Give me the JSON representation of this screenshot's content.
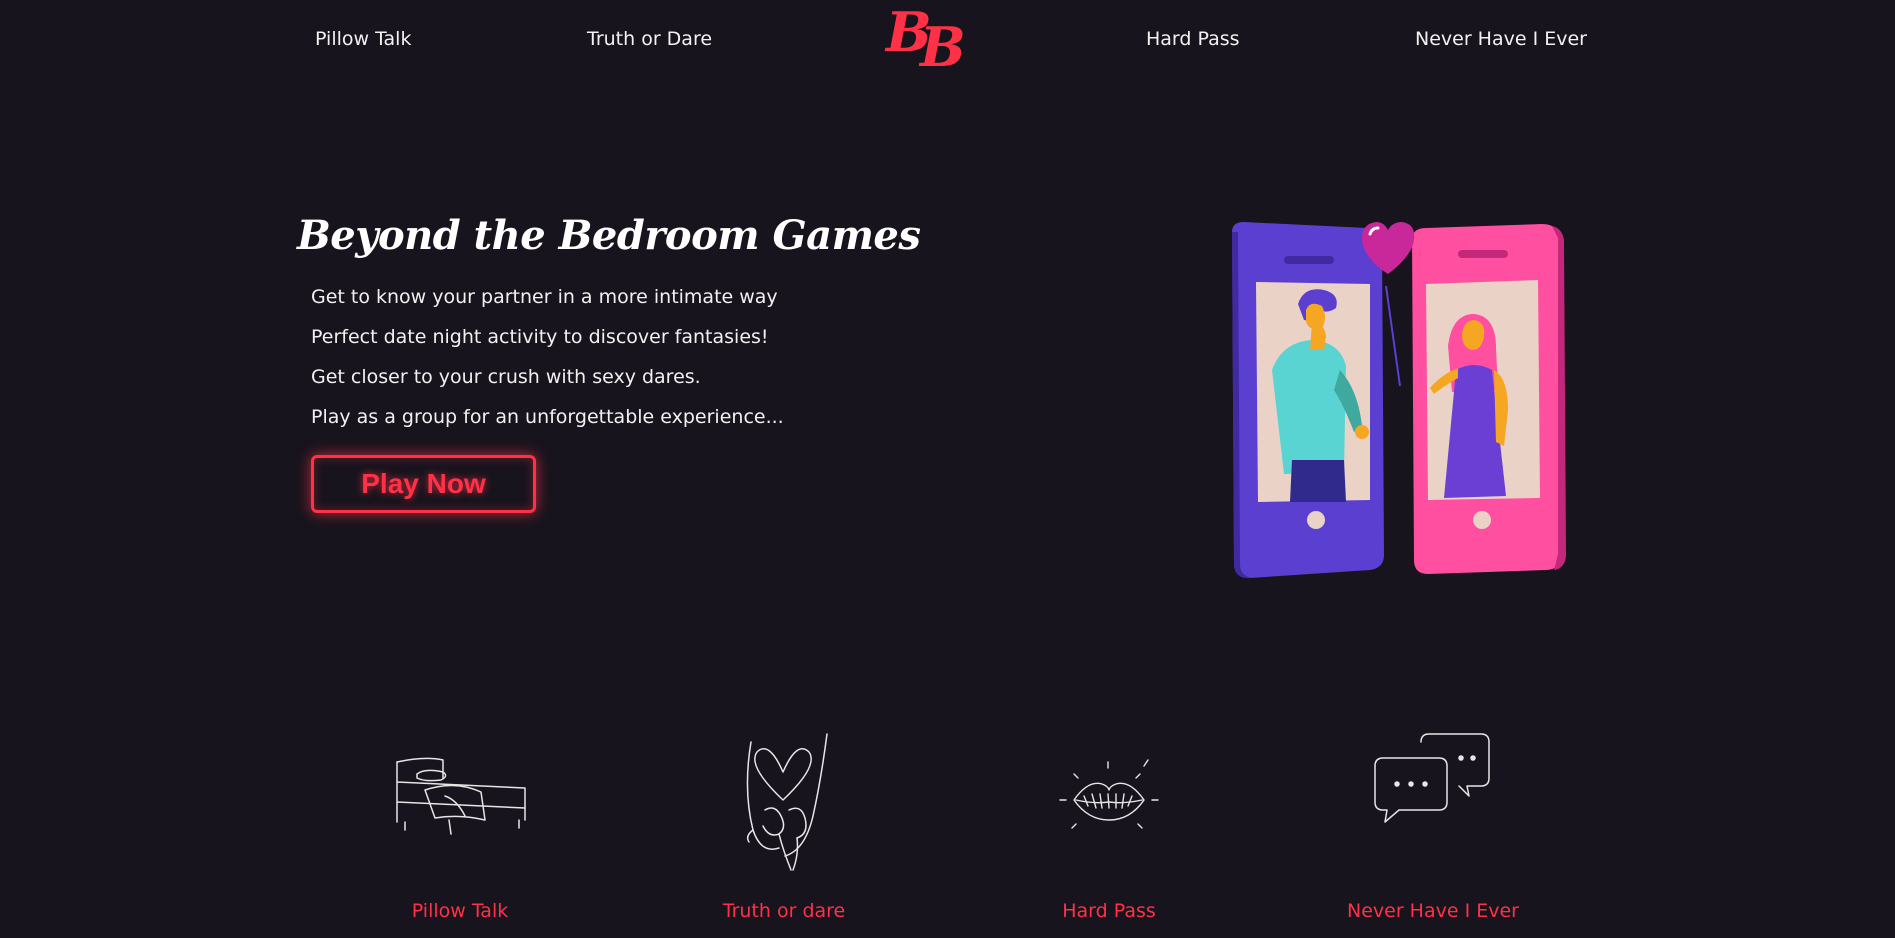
{
  "nav": {
    "items": [
      {
        "label": "Pillow Talk"
      },
      {
        "label": "Truth or Dare"
      },
      {
        "label": "Hard Pass"
      },
      {
        "label": "Never Have I Ever"
      }
    ],
    "logo": {
      "first": "B",
      "second": "B",
      "color": "#ff3146"
    }
  },
  "hero": {
    "title": "Beyond the Bedroom Games",
    "lines": [
      "Get to know your partner in a more intimate way",
      "Perfect date night activity to discover fantasies!",
      "Get closer to your crush with sexy dares.",
      "Play as a group for an unforgettable experience..."
    ],
    "cta_label": "Play Now",
    "illustration_icon": "couple-on-phones-illustration"
  },
  "features": [
    {
      "label": "Pillow Talk",
      "icon": "bed-icon"
    },
    {
      "label": "Truth or dare",
      "icon": "holding-hands-heart-icon"
    },
    {
      "label": "Hard Pass",
      "icon": "lips-icon"
    },
    {
      "label": "Never Have I Ever",
      "icon": "chat-bubbles-icon"
    }
  ],
  "colors": {
    "background": "#17141d",
    "accent": "#ff3146",
    "text": "#ffffff"
  }
}
